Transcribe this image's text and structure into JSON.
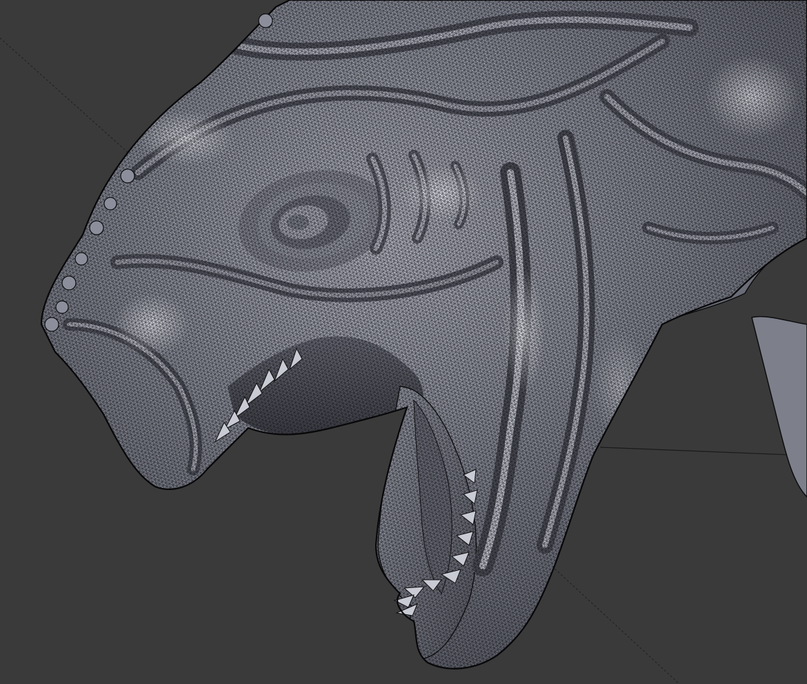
{
  "viewport": {
    "background_color": "#3a3a3a",
    "mesh_fill_color": "#8a8d98",
    "mesh_highlight_color": "#dcdde4",
    "mesh_shadow_color": "#4c4e57",
    "wire_color": "#111114",
    "grid_line_color": "#202020",
    "display_mode": "shaded-wireframe",
    "grid_visible": true
  },
  "model": {
    "icon": "creature-head-mesh-icon"
  }
}
